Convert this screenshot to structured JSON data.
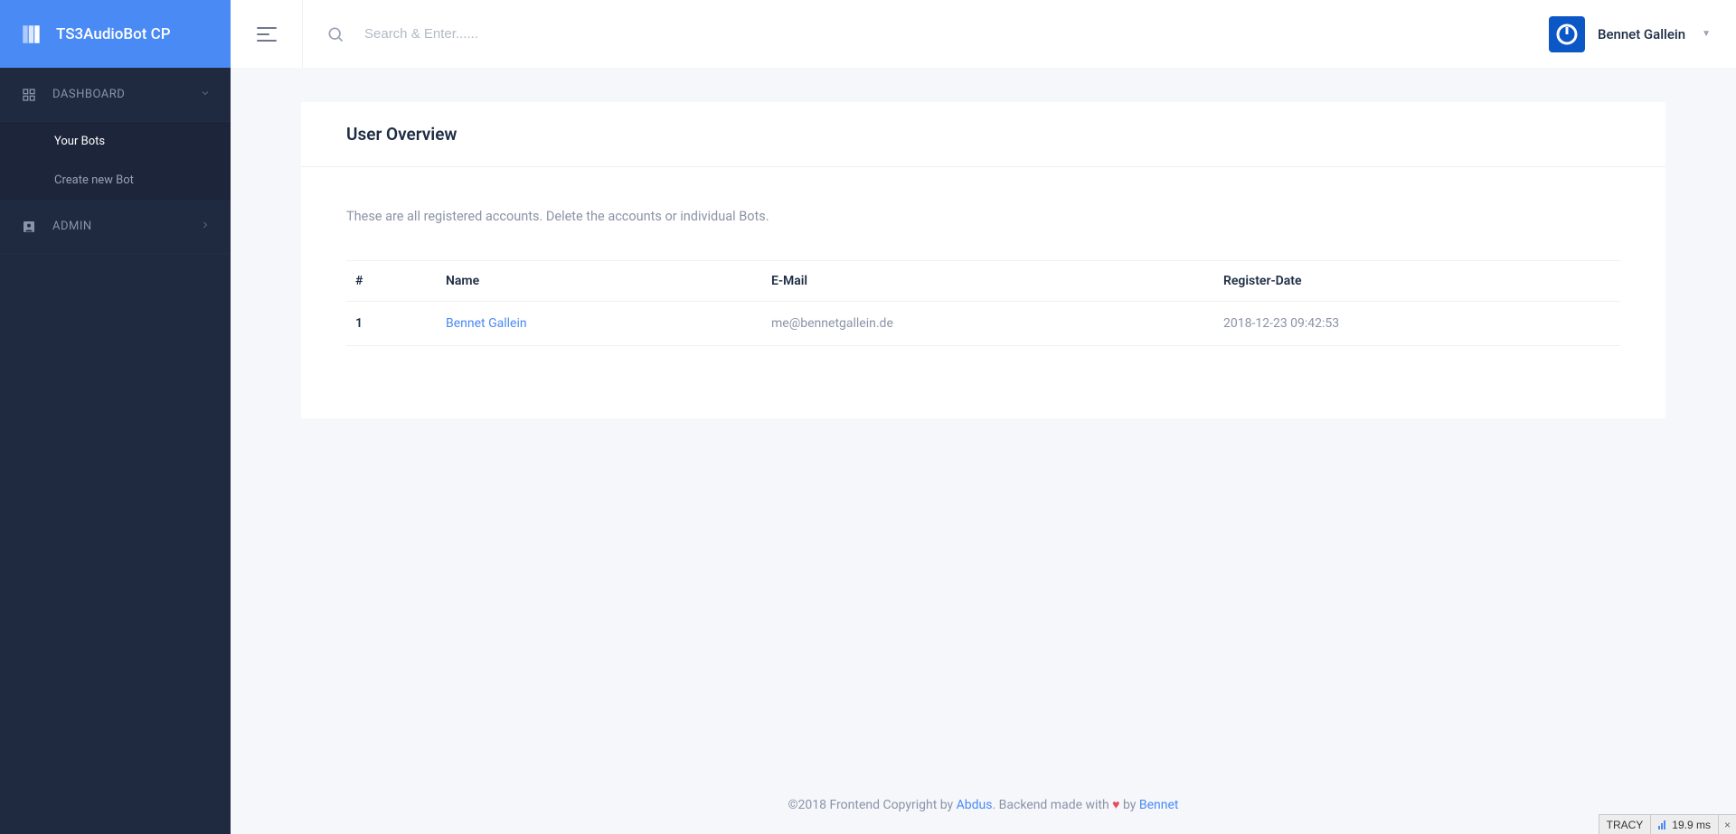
{
  "brand": {
    "title": "TS3AudioBot CP"
  },
  "sidebar": {
    "groups": [
      {
        "label": "DASHBOARD",
        "icon": "dashboard-icon",
        "expanded": true,
        "items": [
          {
            "label": "Your Bots",
            "active": true
          },
          {
            "label": "Create new Bot",
            "active": false
          }
        ]
      },
      {
        "label": "ADMIN",
        "icon": "admin-icon",
        "expanded": false,
        "items": []
      }
    ]
  },
  "topbar": {
    "search_placeholder": "Search & Enter......",
    "user_name": "Bennet Gallein"
  },
  "page": {
    "title": "User Overview",
    "description": "These are all registered accounts. Delete the accounts or individual Bots.",
    "table": {
      "headers": [
        "#",
        "Name",
        "E-Mail",
        "Register-Date"
      ],
      "rows": [
        {
          "id": "1",
          "name": "Bennet Gallein",
          "email": "me@bennetgallein.de",
          "date": "2018-12-23 09:42:53"
        }
      ]
    }
  },
  "footer": {
    "prefix": "©2018 Frontend Copyright by ",
    "link1": "Abdus",
    "mid": ". Backend made with ",
    "heart": "♥",
    "by": " by ",
    "link2": "Bennet"
  },
  "tracy": {
    "label": "TRACY",
    "time": "19.9 ms",
    "close": "×"
  }
}
